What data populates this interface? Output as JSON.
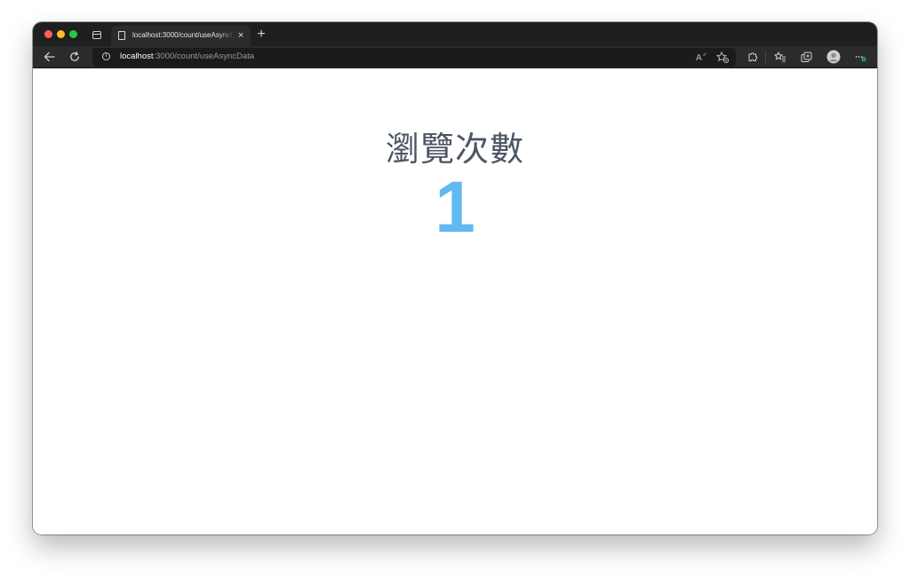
{
  "browser": {
    "tab": {
      "title": "localhost:3000/count/useAsyncData",
      "close_glyph": "×"
    },
    "new_tab_glyph": "+",
    "address_bar": {
      "host": "localhost",
      "path": ":3000/count/useAsyncData"
    },
    "icons": {
      "back": "arrow-left-icon",
      "reload": "reload-icon",
      "site_info": "info-icon",
      "read_aloud": "read-aloud-icon",
      "add_favorite": "star-add-icon",
      "extensions": "puzzle-icon",
      "favorites": "favorites-list-icon",
      "collections": "collections-icon",
      "profile": "profile-avatar-icon",
      "more": "more-dots-icon"
    },
    "colors": {
      "close": "#fe5f57",
      "minimize": "#febc2e",
      "maximize": "#28c840"
    }
  },
  "page": {
    "heading": "瀏覽次數",
    "count": "1",
    "colors": {
      "heading": "#4b5563",
      "count": "#60b9ef"
    }
  }
}
